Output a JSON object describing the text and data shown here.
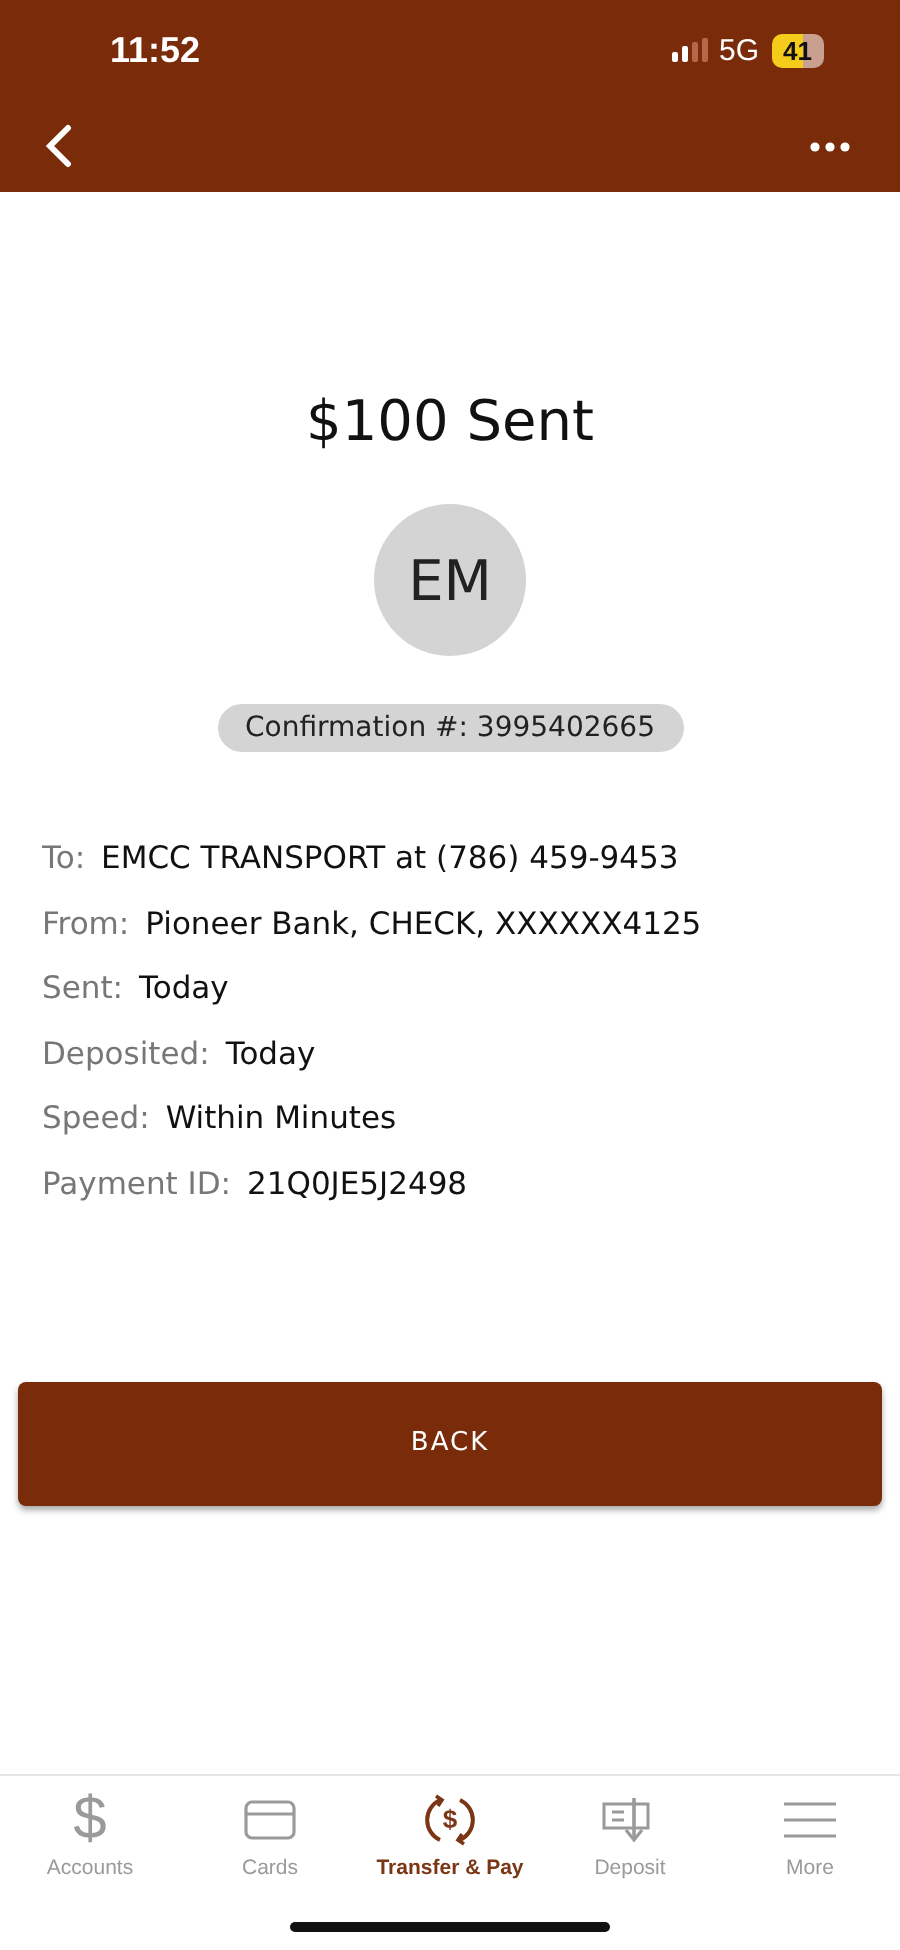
{
  "status_bar": {
    "time": "11:52",
    "network": "5G",
    "battery": "41"
  },
  "title": "$100 Sent",
  "avatar": {
    "initials": "EM"
  },
  "confirmation": "Confirmation #: 3995402665",
  "details": [
    {
      "label": "To:",
      "value": "EMCC TRANSPORT at (786) 459-9453"
    },
    {
      "label": "From:",
      "value": "Pioneer Bank, CHECK, XXXXXX4125"
    },
    {
      "label": "Sent:",
      "value": "Today"
    },
    {
      "label": "Deposited:",
      "value": "Today"
    },
    {
      "label": "Speed:",
      "value": "Within Minutes"
    },
    {
      "label": "Payment ID:",
      "value": "21Q0JE5J2498"
    }
  ],
  "back_button": "BACK",
  "tabs": [
    {
      "kind": "accounts",
      "icon_text": "$",
      "label": "Accounts",
      "selected": false
    },
    {
      "kind": "cards",
      "label": "Cards",
      "selected": false
    },
    {
      "kind": "transfer",
      "icon_text": "$",
      "label": "Transfer & Pay",
      "selected": true
    },
    {
      "kind": "deposit",
      "label": "Deposit",
      "selected": false
    },
    {
      "kind": "more",
      "label": "More",
      "selected": false
    }
  ]
}
